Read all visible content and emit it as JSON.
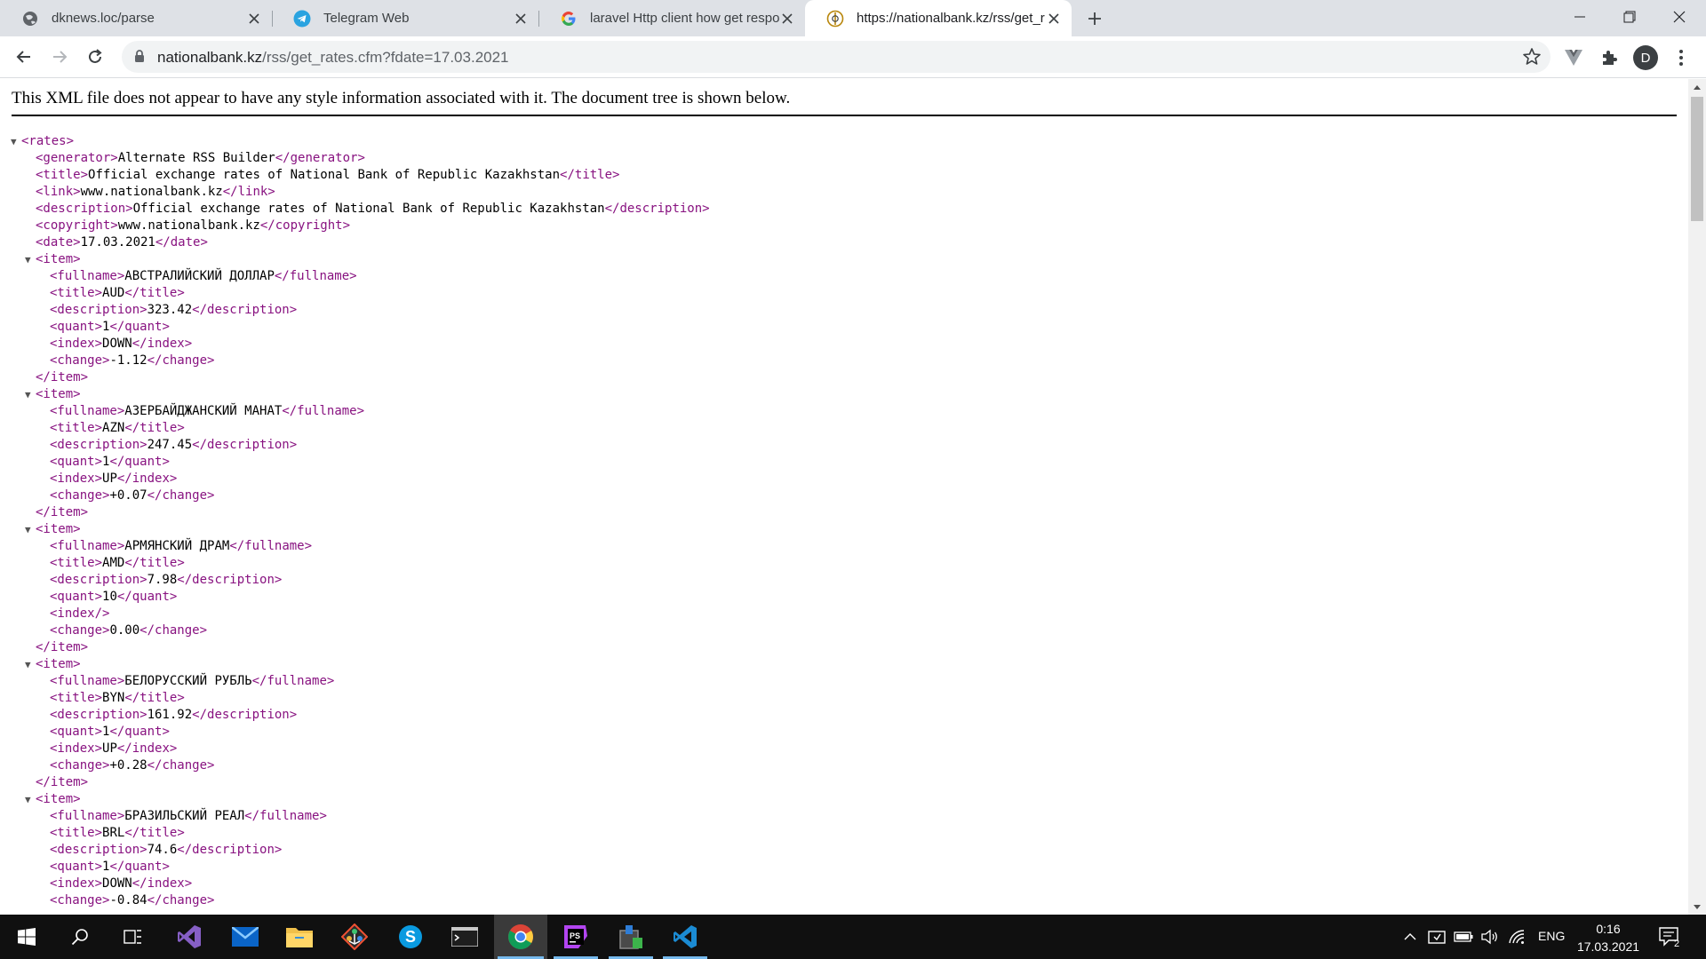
{
  "tabs": [
    {
      "title": "dknews.loc/parse",
      "icon": "globe-icon"
    },
    {
      "title": "Telegram Web",
      "icon": "telegram-icon"
    },
    {
      "title": "laravel Http client how get respo",
      "icon": "google-icon"
    },
    {
      "title": "https://nationalbank.kz/rss/get_r",
      "icon": "nationalbank-icon",
      "active": true
    }
  ],
  "toolbar": {
    "url_host": "nationalbank.kz",
    "url_path": "/rss/get_rates.cfm?fdate=17.03.2021",
    "avatar_letter": "D"
  },
  "xml_notice": "This XML file does not appear to have any style information associated with it. The document tree is shown below.",
  "rates": {
    "generator": "Alternate RSS Builder",
    "title": "Official exchange rates of National Bank of Republic Kazakhstan",
    "link": "www.nationalbank.kz",
    "description": "Official exchange rates of National Bank of Republic Kazakhstan",
    "copyright": "www.nationalbank.kz",
    "date": "17.03.2021",
    "items": [
      {
        "fullname": "АВСТРАЛИЙСКИЙ ДОЛЛАР",
        "title": "AUD",
        "description": "323.42",
        "quant": "1",
        "index": "DOWN",
        "change": "-1.12"
      },
      {
        "fullname": "АЗЕРБАЙДЖАНСКИЙ МАНАТ",
        "title": "AZN",
        "description": "247.45",
        "quant": "1",
        "index": "UP",
        "change": "+0.07"
      },
      {
        "fullname": "АРМЯНСКИЙ ДРАМ",
        "title": "AMD",
        "description": "7.98",
        "quant": "10",
        "index": "",
        "change": "0.00"
      },
      {
        "fullname": "БЕЛОРУССКИЙ РУБЛЬ",
        "title": "BYN",
        "description": "161.92",
        "quant": "1",
        "index": "UP",
        "change": "+0.28"
      },
      {
        "fullname": "БРАЗИЛЬСКИЙ РЕАЛ",
        "title": "BRL",
        "description": "74.6",
        "quant": "1",
        "index": "DOWN",
        "change": "-0.84"
      }
    ]
  },
  "taskbar": {
    "apps": [
      "windows-start",
      "search",
      "task-view",
      "visual-studio",
      "mail",
      "file-explorer",
      "git-kraken",
      "skype",
      "terminal",
      "chrome",
      "phpstorm",
      "app-installer",
      "vscode"
    ],
    "lang": "ENG",
    "time": "0:16",
    "date": "17.03.2021",
    "notification_count": "2"
  }
}
